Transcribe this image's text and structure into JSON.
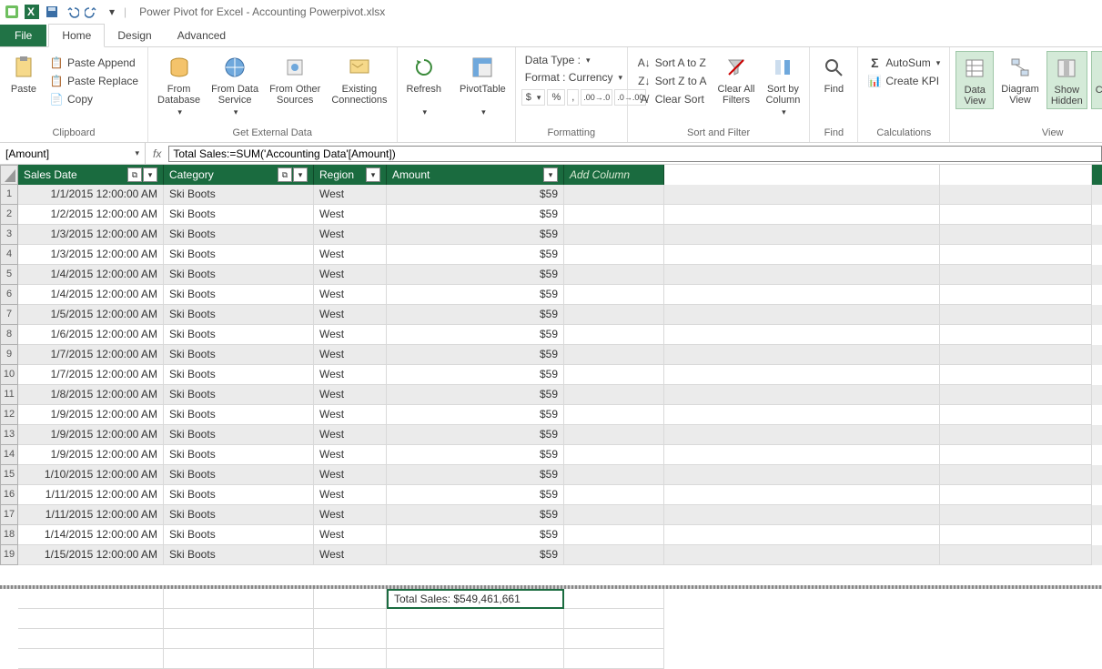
{
  "title": "Power Pivot for Excel - Accounting Powerpivot.xlsx",
  "tabs": {
    "file": "File",
    "home": "Home",
    "design": "Design",
    "advanced": "Advanced"
  },
  "ribbon": {
    "clipboard": {
      "paste": "Paste",
      "pasteAppend": "Paste Append",
      "pasteReplace": "Paste Replace",
      "copy": "Copy",
      "group": "Clipboard"
    },
    "getdata": {
      "fromDb": "From\nDatabase",
      "fromDs": "From Data\nService",
      "fromOther": "From Other\nSources",
      "existing": "Existing\nConnections",
      "group": "Get External Data"
    },
    "refresh": {
      "refresh": "Refresh",
      "pivot": "PivotTable"
    },
    "formatting": {
      "dataTypeLabel": "Data Type :",
      "formatLabel": "Format : Currency",
      "group": "Formatting"
    },
    "sort": {
      "az": "Sort A to Z",
      "za": "Sort Z to A",
      "clear": "Clear Sort",
      "clearAll": "Clear All\nFilters",
      "byCol": "Sort by\nColumn",
      "group": "Sort and Filter"
    },
    "find": {
      "find": "Find",
      "group": "Find"
    },
    "calc": {
      "autosum": "AutoSum",
      "kpi": "Create KPI",
      "group": "Calculations"
    },
    "view": {
      "dataView": "Data\nView",
      "diagram": "Diagram\nView",
      "showHidden": "Show\nHidden",
      "calcArea": "Calculation\nArea",
      "group": "View"
    }
  },
  "formulabar": {
    "name": "[Amount]",
    "fx": "fx",
    "formula": "Total Sales:=SUM('Accounting Data'[Amount])"
  },
  "columns": {
    "w": {
      "rownum": 20,
      "date": 160,
      "cat": 165,
      "region": 80,
      "amount": 195,
      "addcol": 110,
      "gap1": 303,
      "gap2": 167
    },
    "headers": {
      "date": "Sales Date",
      "cat": "Category",
      "region": "Region",
      "amount": "Amount",
      "addcol": "Add Column"
    }
  },
  "rows": [
    {
      "date": "1/1/2015 12:00:00 AM",
      "cat": "Ski Boots",
      "region": "West",
      "amount": "$59"
    },
    {
      "date": "1/2/2015 12:00:00 AM",
      "cat": "Ski Boots",
      "region": "West",
      "amount": "$59"
    },
    {
      "date": "1/3/2015 12:00:00 AM",
      "cat": "Ski Boots",
      "region": "West",
      "amount": "$59"
    },
    {
      "date": "1/3/2015 12:00:00 AM",
      "cat": "Ski Boots",
      "region": "West",
      "amount": "$59"
    },
    {
      "date": "1/4/2015 12:00:00 AM",
      "cat": "Ski Boots",
      "region": "West",
      "amount": "$59"
    },
    {
      "date": "1/4/2015 12:00:00 AM",
      "cat": "Ski Boots",
      "region": "West",
      "amount": "$59"
    },
    {
      "date": "1/5/2015 12:00:00 AM",
      "cat": "Ski Boots",
      "region": "West",
      "amount": "$59"
    },
    {
      "date": "1/6/2015 12:00:00 AM",
      "cat": "Ski Boots",
      "region": "West",
      "amount": "$59"
    },
    {
      "date": "1/7/2015 12:00:00 AM",
      "cat": "Ski Boots",
      "region": "West",
      "amount": "$59"
    },
    {
      "date": "1/7/2015 12:00:00 AM",
      "cat": "Ski Boots",
      "region": "West",
      "amount": "$59"
    },
    {
      "date": "1/8/2015 12:00:00 AM",
      "cat": "Ski Boots",
      "region": "West",
      "amount": "$59"
    },
    {
      "date": "1/9/2015 12:00:00 AM",
      "cat": "Ski Boots",
      "region": "West",
      "amount": "$59"
    },
    {
      "date": "1/9/2015 12:00:00 AM",
      "cat": "Ski Boots",
      "region": "West",
      "amount": "$59"
    },
    {
      "date": "1/9/2015 12:00:00 AM",
      "cat": "Ski Boots",
      "region": "West",
      "amount": "$59"
    },
    {
      "date": "1/10/2015 12:00:00 AM",
      "cat": "Ski Boots",
      "region": "West",
      "amount": "$59"
    },
    {
      "date": "1/11/2015 12:00:00 AM",
      "cat": "Ski Boots",
      "region": "West",
      "amount": "$59"
    },
    {
      "date": "1/11/2015 12:00:00 AM",
      "cat": "Ski Boots",
      "region": "West",
      "amount": "$59"
    },
    {
      "date": "1/14/2015 12:00:00 AM",
      "cat": "Ski Boots",
      "region": "West",
      "amount": "$59"
    },
    {
      "date": "1/15/2015 12:00:00 AM",
      "cat": "Ski Boots",
      "region": "West",
      "amount": "$59"
    }
  ],
  "calc": {
    "totalSales": "Total Sales: $549,461,661"
  }
}
